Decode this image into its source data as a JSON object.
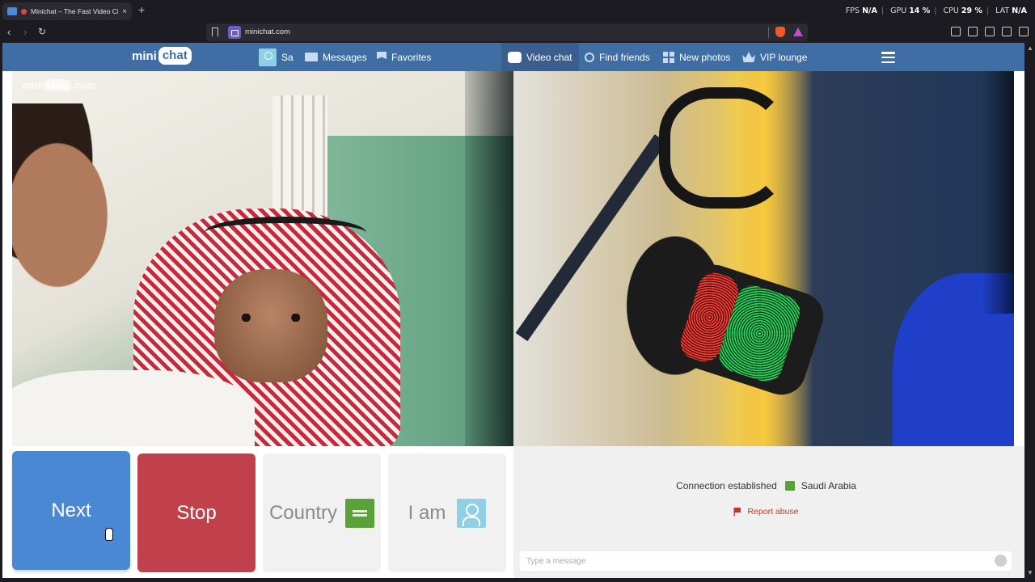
{
  "browser": {
    "tab_title": "Minichat – The Fast Video Ch",
    "new_tab": "+",
    "tab_close": "×",
    "url": "minichat.com",
    "stats": {
      "fps_label": "FPS",
      "fps_value": "N/A",
      "gpu_label": "GPU",
      "gpu_value": "14 %",
      "cpu_label": "CPU",
      "cpu_value": "29 %",
      "lat_label": "LAT",
      "lat_value": "N/A"
    }
  },
  "header": {
    "logo_mini": "mini",
    "logo_chat": "chat",
    "user_name": "Sa",
    "messages": "Messages",
    "favorites": "Favorites",
    "video_chat": "Video chat",
    "find_friends": "Find friends",
    "new_photos": "New photos",
    "vip_lounge": "VIP lounge"
  },
  "video": {
    "watermark_mini": "mini",
    "watermark_chat": "chat",
    "watermark_domain": ".com"
  },
  "controls": {
    "next": "Next",
    "stop": "Stop",
    "country": "Country",
    "i_am": "I am"
  },
  "chat": {
    "connection_text": "Connection established",
    "country": "Saudi Arabia",
    "report_abuse": "Report abuse",
    "message_placeholder": "Type a message"
  },
  "colors": {
    "header_bg": "#3f6ea5",
    "next_bg": "#4a88d4",
    "stop_bg": "#c0404b",
    "report": "#c0392b"
  }
}
